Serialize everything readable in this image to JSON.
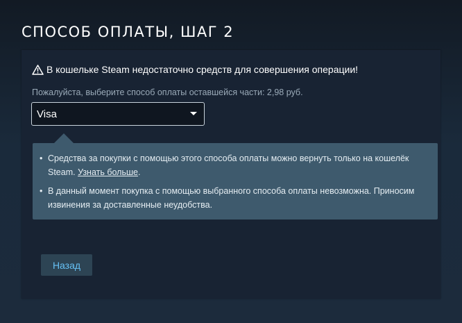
{
  "page": {
    "title": "СПОСОБ ОПЛАТЫ, ШАГ 2"
  },
  "warning": {
    "icon": "warning-triangle-icon",
    "text": "В кошельке Steam недостаточно средств для совершения операции!"
  },
  "instruction": "Пожалуйста, выберите способ оплаты оставшейся части: 2,98 руб.",
  "payment_select": {
    "selected": "Visa"
  },
  "tooltip": {
    "items": [
      {
        "text": "Средства за покупки с помощью этого способа оплаты можно вернуть только на кошелёк Steam. ",
        "link": "Узнать больше",
        "suffix": "."
      },
      {
        "text": "В данный момент покупка с помощью выбранного способа оплаты невозможна. Приносим извинения за доставленные неудобства."
      }
    ]
  },
  "buttons": {
    "back": "Назад"
  },
  "colors": {
    "accent": "#66c0f4",
    "tooltip_bg": "#3e5a6d",
    "panel_bg": "#182333"
  }
}
